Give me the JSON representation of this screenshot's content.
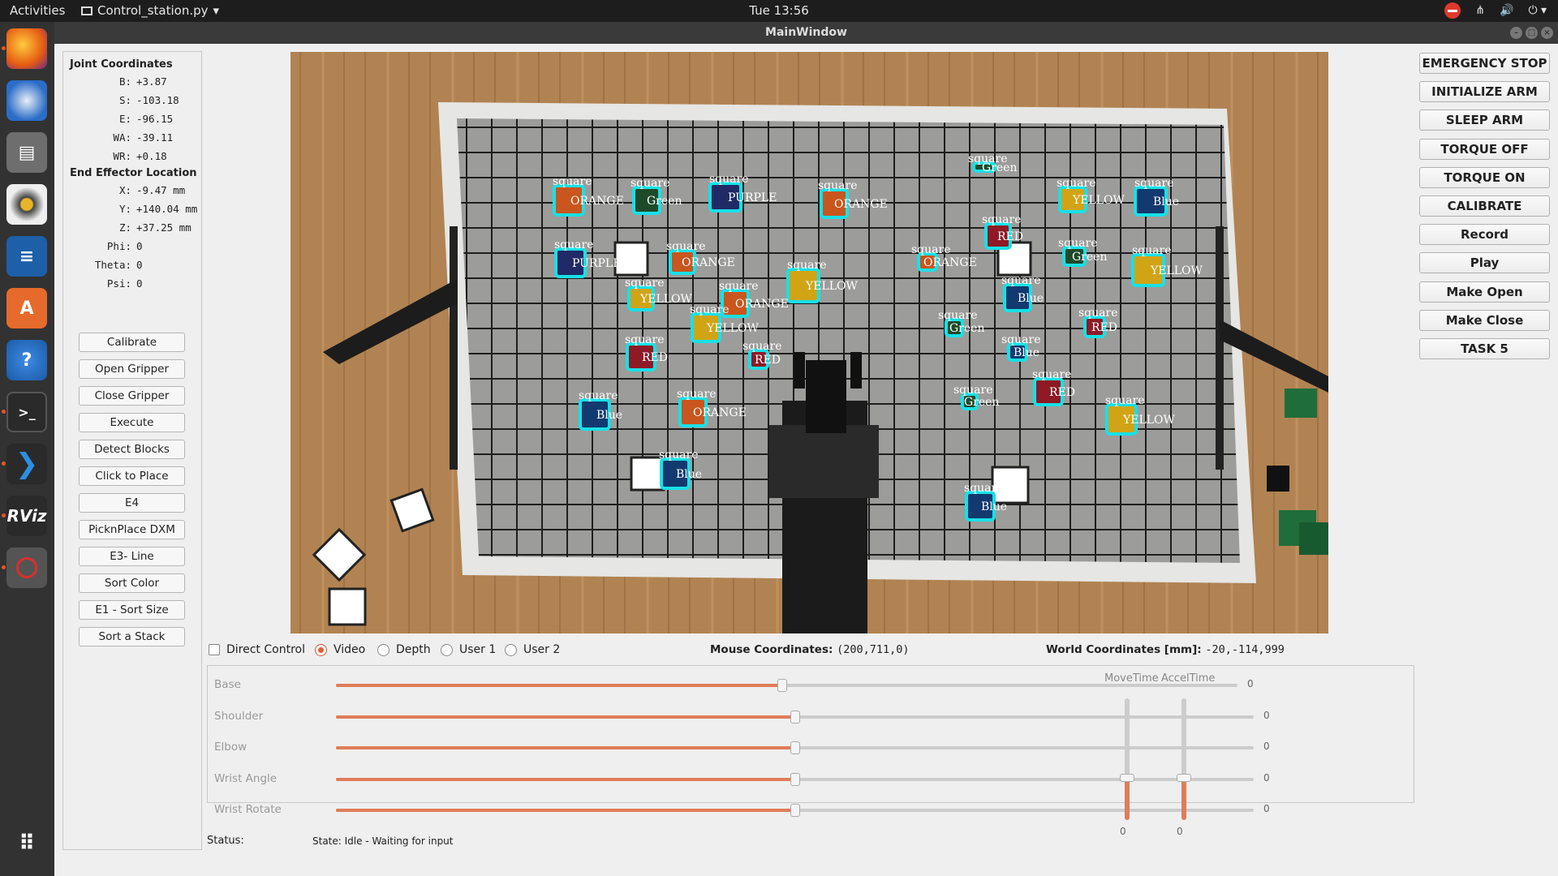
{
  "topbar": {
    "activities": "Activities",
    "app_name": "Control_station.py",
    "app_arrow": "▾",
    "clock": "Tue 13:56",
    "tray_icons": [
      "no-entry-icon",
      "network-icon",
      "volume-icon",
      "power-icon"
    ]
  },
  "window": {
    "title": "MainWindow"
  },
  "dock": {
    "apps": [
      "firefox-icon",
      "thunderbird-icon",
      "files-icon",
      "rhythmbox-icon",
      "writer-icon",
      "software-center-icon",
      "help-icon",
      "terminal-icon",
      "vscode-icon",
      "rviz-icon",
      "control-station-icon",
      "app-grid-icon"
    ]
  },
  "joint": {
    "title": "Joint Coordinates",
    "rows": [
      {
        "k": "B:",
        "v": "+3.87"
      },
      {
        "k": "S:",
        "v": "-103.18"
      },
      {
        "k": "E:",
        "v": "-96.15"
      },
      {
        "k": "WA:",
        "v": "-39.11"
      },
      {
        "k": "WR:",
        "v": "+0.18"
      }
    ]
  },
  "ee": {
    "title": "End Effector Location",
    "rows": [
      {
        "k": "X:",
        "v": "-9.47 mm"
      },
      {
        "k": "Y:",
        "v": "+140.04 mm"
      },
      {
        "k": "Z:",
        "v": "+37.25 mm"
      },
      {
        "k": "Phi:",
        "v": "0"
      },
      {
        "k": "Theta:",
        "v": "0"
      },
      {
        "k": "Psi:",
        "v": "0"
      }
    ]
  },
  "left_buttons": [
    "Calibrate",
    "Open Gripper",
    "Close Gripper",
    "Execute",
    "Detect Blocks",
    "Click to Place",
    "E4",
    "PicknPlace DXM",
    "E3- Line",
    "Sort Color",
    "E1 - Sort Size",
    "Sort a Stack"
  ],
  "right_buttons": [
    "EMERGENCY STOP",
    "INITIALIZE ARM",
    "SLEEP ARM",
    "TORQUE OFF",
    "TORQUE ON",
    "CALIBRATE",
    "Record",
    "Play",
    "Make Open",
    "Make Close",
    "TASK 5"
  ],
  "modes": {
    "direct_control": "Direct Control",
    "video": "Video",
    "depth": "Depth",
    "user1": "User 1",
    "user2": "User 2",
    "selected": "Video"
  },
  "mouse": {
    "label": "Mouse Coordinates:",
    "value": "(200,711,0)"
  },
  "world": {
    "label": "World Coordinates [mm]:",
    "value": "-20,-114,999"
  },
  "sliders": [
    {
      "label": "Base",
      "value": "0",
      "level": 0.5
    },
    {
      "label": "Shoulder",
      "value": "0",
      "level": 0.5
    },
    {
      "label": "Elbow",
      "value": "0",
      "level": 0.5
    },
    {
      "label": "Wrist Angle",
      "value": "0",
      "level": 0.5
    },
    {
      "label": "Wrist Rotate",
      "value": "0",
      "level": 0.5
    }
  ],
  "vsliders": [
    {
      "label": "MoveTime",
      "value": "0",
      "level": 0.35
    },
    {
      "label": "AccelTime",
      "value": "0",
      "level": 0.35
    }
  ],
  "status": {
    "label": "Status:",
    "text": "State: Idle - Waiting for input"
  },
  "detections": [
    {
      "shape": "square",
      "color": "ORANGE",
      "fill": "#c8561e"
    },
    {
      "shape": "square",
      "color": "Green",
      "fill": "#1e4a2a"
    },
    {
      "shape": "square",
      "color": "PURPLE",
      "fill": "#1f2a66"
    },
    {
      "shape": "square",
      "color": "ORANGE",
      "fill": "#c8561e"
    },
    {
      "shape": "square",
      "color": "Green",
      "fill": "#1e4a2a"
    },
    {
      "shape": "square",
      "color": "YELLOW",
      "fill": "#d1a416"
    },
    {
      "shape": "square",
      "color": "Blue",
      "fill": "#123a70"
    },
    {
      "shape": "square",
      "color": "PURPLE",
      "fill": "#1f2a66"
    },
    {
      "shape": "square",
      "color": "ORANGE",
      "fill": "#c8561e"
    },
    {
      "shape": "square",
      "color": "ORANGE",
      "fill": "#c8561e"
    },
    {
      "shape": "square",
      "color": "RED",
      "fill": "#8e1a26"
    },
    {
      "shape": "square",
      "color": "Green",
      "fill": "#1e4a2a"
    },
    {
      "shape": "square",
      "color": "YELLOW",
      "fill": "#d1a416"
    },
    {
      "shape": "square",
      "color": "YELLOW",
      "fill": "#d1a416"
    },
    {
      "shape": "square",
      "color": "YELLOW",
      "fill": "#d1a416"
    },
    {
      "shape": "square",
      "color": "ORANGE",
      "fill": "#c8561e"
    },
    {
      "shape": "square",
      "color": "Blue",
      "fill": "#123a70"
    },
    {
      "shape": "square",
      "color": "YELLOW",
      "fill": "#d1a416"
    },
    {
      "shape": "square",
      "color": "Green",
      "fill": "#1e4a2a"
    },
    {
      "shape": "square",
      "color": "RED",
      "fill": "#8e1a26"
    },
    {
      "shape": "square",
      "color": "RED",
      "fill": "#8e1a26"
    },
    {
      "shape": "square",
      "color": "RED",
      "fill": "#8e1a26"
    },
    {
      "shape": "square",
      "color": "Blue",
      "fill": "#123a70"
    },
    {
      "shape": "square",
      "color": "RED",
      "fill": "#8e1a26"
    },
    {
      "shape": "square",
      "color": "Blue",
      "fill": "#123a70"
    },
    {
      "shape": "square",
      "color": "ORANGE",
      "fill": "#c8561e"
    },
    {
      "shape": "square",
      "color": "Green",
      "fill": "#1e4a2a"
    },
    {
      "shape": "square",
      "color": "YELLOW",
      "fill": "#d1a416"
    },
    {
      "shape": "square",
      "color": "Blue",
      "fill": "#123a70"
    },
    {
      "shape": "square",
      "color": "Blue",
      "fill": "#123a70"
    }
  ],
  "colors": {
    "accent": "#e07c58",
    "outline": "#19e0e6"
  }
}
